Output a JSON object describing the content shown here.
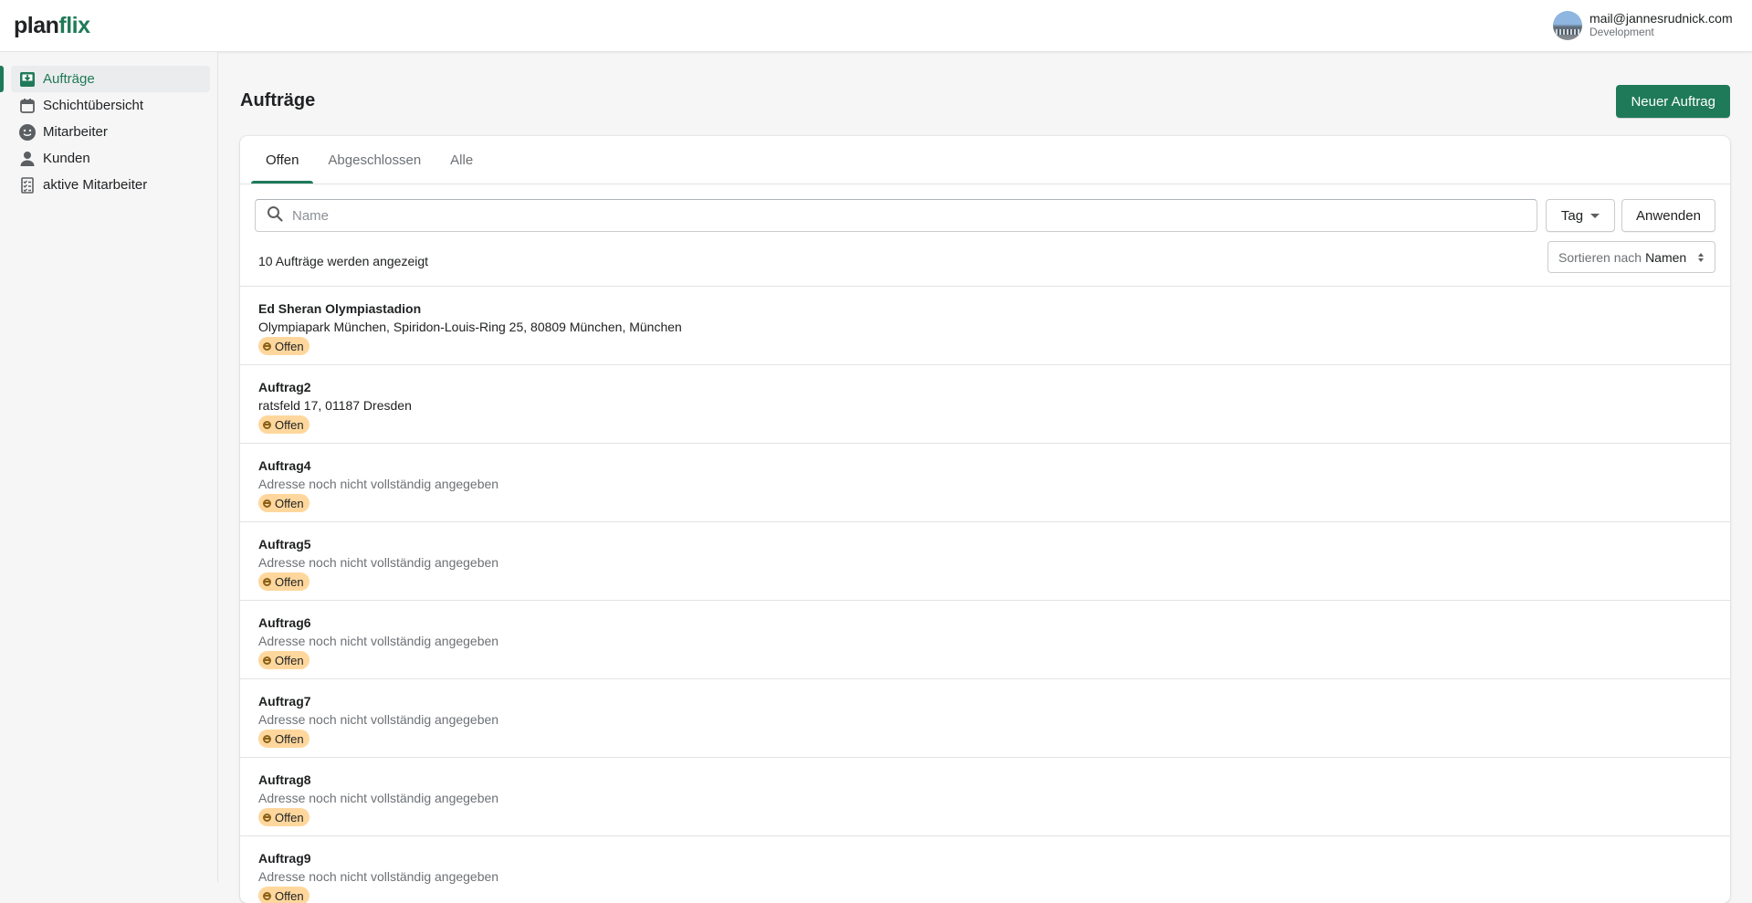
{
  "app": {
    "logo_part1": "plan",
    "logo_part2": "flix",
    "user_email": "mail@jannesrudnick.com",
    "user_role": "Development"
  },
  "sidebar": {
    "items": [
      {
        "label": "Aufträge",
        "icon": "inbox-icon",
        "active": true
      },
      {
        "label": "Schichtübersicht",
        "icon": "calendar-icon",
        "active": false
      },
      {
        "label": "Mitarbeiter",
        "icon": "smiley-icon",
        "active": false
      },
      {
        "label": "Kunden",
        "icon": "person-icon",
        "active": false
      },
      {
        "label": "aktive Mitarbeiter",
        "icon": "checklist-icon",
        "active": false
      }
    ]
  },
  "page": {
    "title": "Aufträge",
    "new_button": "Neuer Auftrag"
  },
  "tabs": [
    "Offen",
    "Abgeschlossen",
    "Alle"
  ],
  "filters": {
    "search_placeholder": "Name",
    "tag_label": "Tag",
    "apply_label": "Anwenden"
  },
  "results": {
    "count_text": "10 Aufträge werden angezeigt",
    "sort_label": "Sortieren nach",
    "sort_value": "Namen"
  },
  "orders": [
    {
      "name": "Ed Sheran Olympiastadion",
      "address": "Olympiapark München, Spiridon-Louis-Ring 25, 80809 München, München",
      "status": "Offen"
    },
    {
      "name": "Auftrag2",
      "address": "ratsfeld 17, 01187 Dresden",
      "status": "Offen"
    },
    {
      "name": "Auftrag4",
      "address": "Adresse noch nicht vollständig angegeben",
      "status": "Offen"
    },
    {
      "name": "Auftrag5",
      "address": "Adresse noch nicht vollständig angegeben",
      "status": "Offen"
    },
    {
      "name": "Auftrag6",
      "address": "Adresse noch nicht vollständig angegeben",
      "status": "Offen"
    },
    {
      "name": "Auftrag7",
      "address": "Adresse noch nicht vollständig angegeben",
      "status": "Offen"
    },
    {
      "name": "Auftrag8",
      "address": "Adresse noch nicht vollständig angegeben",
      "status": "Offen"
    },
    {
      "name": "Auftrag9",
      "address": "Adresse noch nicht vollständig angegeben",
      "status": "Offen"
    }
  ],
  "colors": {
    "brand": "#1f7a59",
    "badge_attention": "#ffd79d"
  }
}
